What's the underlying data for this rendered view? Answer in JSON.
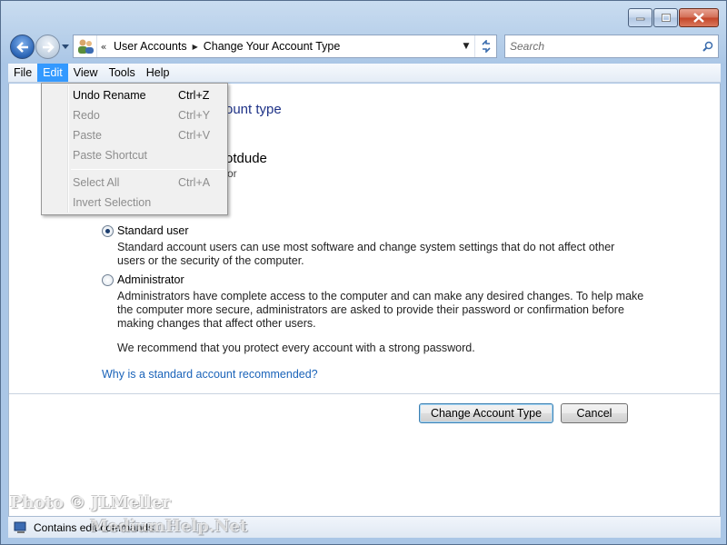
{
  "address": {
    "crumbs": [
      "User Accounts",
      "Change Your Account Type"
    ]
  },
  "search": {
    "placeholder": "Search"
  },
  "menu": {
    "items": [
      "File",
      "Edit",
      "View",
      "Tools",
      "Help"
    ],
    "active": "Edit"
  },
  "edit_menu": {
    "items": [
      {
        "label": "Undo Rename",
        "shortcut": "Ctrl+Z",
        "enabled": true
      },
      {
        "label": "Redo",
        "shortcut": "Ctrl+Y",
        "enabled": false
      },
      {
        "label": "Paste",
        "shortcut": "Ctrl+V",
        "enabled": false
      },
      {
        "label": "Paste Shortcut",
        "shortcut": "",
        "enabled": false
      },
      {
        "label": "Select All",
        "shortcut": "Ctrl+A",
        "enabled": false
      },
      {
        "label": "Invert Selection",
        "shortcut": "",
        "enabled": false
      }
    ]
  },
  "content": {
    "heading_partial": "ount type",
    "account_name_partial": "otdude",
    "account_type_partial": "or",
    "options": [
      {
        "label": "Standard user",
        "selected": true,
        "description": "Standard account users can use most software and change system settings that do not affect other users or the security of the computer."
      },
      {
        "label": "Administrator",
        "selected": false,
        "description": "Administrators have complete access to the computer and can make any desired changes. To help make the computer more secure, administrators are asked to provide their password or confirmation before making changes that affect other users."
      }
    ],
    "recommendation": "We recommend that you protect every account with a strong password.",
    "help_link": "Why is a standard account recommended?"
  },
  "buttons": {
    "change": "Change Account Type",
    "cancel": "Cancel"
  },
  "status": {
    "text": "Contains edit commands."
  },
  "watermark": {
    "line1": "Photo © JLMeller",
    "line2": "MediumHelp.Net"
  },
  "colors": {
    "accent": "#3399ff",
    "heading": "#1e3287",
    "link": "#1a63b9"
  }
}
